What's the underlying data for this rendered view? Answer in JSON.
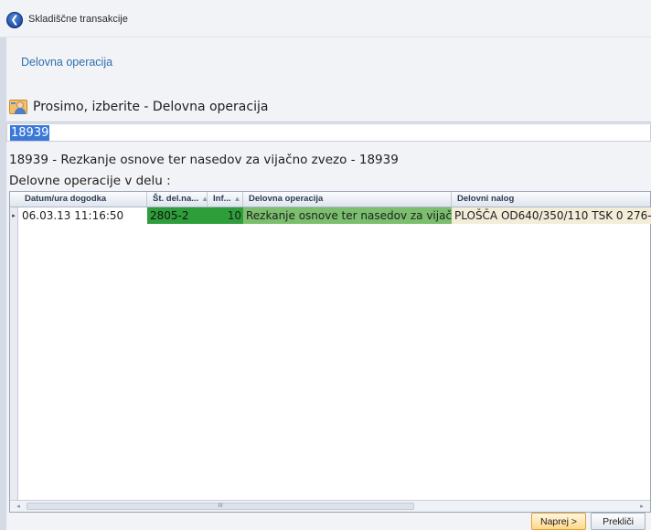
{
  "window": {
    "title": "Skladiščne transakcije"
  },
  "breadcrumb": "Delovna operacija",
  "prompt": "Prosimo, izberite - Delovna operacija",
  "search": {
    "value": "18939"
  },
  "selection_info": "18939 - Rezkanje osnove ter nasedov za vijačno zvezo - 18939",
  "section_label": "Delovne operacije v delu :",
  "grid": {
    "columns": [
      {
        "label": "Datum/ura dogodka",
        "sort": ""
      },
      {
        "label": "Št. del.na...",
        "sort": "▲"
      },
      {
        "label": "Inf...",
        "sort": "▲"
      },
      {
        "label": "Delovna operacija",
        "sort": ""
      },
      {
        "label": "Delovni nalog",
        "sort": ""
      }
    ],
    "rows": [
      {
        "indicator": "▸",
        "date": "06.03.13 11:16:50",
        "st_del": "2805-2",
        "inf": "10",
        "operation": "Rezkanje osnove ter nasedov za vijač...",
        "order": "PLOŠČA OD640/350/110 TSK 0 276-..."
      }
    ]
  },
  "scroll": {
    "left_arrow": "◂",
    "right_arrow": "▸",
    "thumb_grip": "III"
  },
  "buttons": {
    "next": "Naprej >",
    "cancel": "Prekliči"
  },
  "colors": {
    "accent_blue": "#2f6fad",
    "selected_text_bg": "#3b78d8",
    "cell_green_dark": "#2e9e3a",
    "cell_green_light": "#7bbf6e",
    "cell_beige": "#f3ecd9"
  },
  "icons": {
    "back": "back-arrow-icon",
    "prompt": "user-card-icon"
  }
}
